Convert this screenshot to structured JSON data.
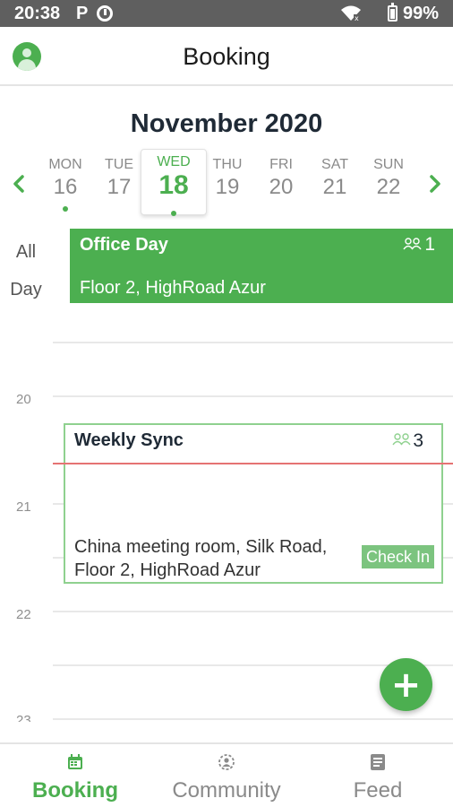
{
  "status_bar": {
    "time": "20:38",
    "notif_p": "P",
    "battery": "99%"
  },
  "header": {
    "title": "Booking",
    "avatar_icon": "user-icon"
  },
  "calendar": {
    "month": "November 2020",
    "prev_icon": "chevron-left-icon",
    "next_icon": "chevron-right-icon",
    "days": [
      {
        "name": "MON",
        "num": "16",
        "has_event": true
      },
      {
        "name": "TUE",
        "num": "17",
        "has_event": false
      },
      {
        "name": "WED",
        "num": "18",
        "has_event": true,
        "selected": true
      },
      {
        "name": "THU",
        "num": "19",
        "has_event": false
      },
      {
        "name": "FRI",
        "num": "20",
        "has_event": false
      },
      {
        "name": "SAT",
        "num": "21",
        "has_event": false
      },
      {
        "name": "SUN",
        "num": "22",
        "has_event": false
      }
    ]
  },
  "all_day": {
    "label_line1": "All",
    "label_line2": "Day",
    "event": {
      "title": "Office Day",
      "location": "Floor 2, HighRoad Azur",
      "attendees": "1"
    }
  },
  "timeline": {
    "hours": [
      "20",
      "21",
      "22",
      "23"
    ],
    "event": {
      "title": "Weekly Sync",
      "attendees": "3",
      "location_line1": "China meeting room, Silk Road,",
      "location_line2": "Floor 2, HighRoad Azur",
      "checkin_label": "Check In"
    }
  },
  "fab": {
    "label": "+"
  },
  "bottom_nav": {
    "tabs": [
      {
        "label": "Booking",
        "icon": "calendar-icon",
        "active": true
      },
      {
        "label": "Community",
        "icon": "community-icon",
        "active": false
      },
      {
        "label": "Feed",
        "icon": "feed-icon",
        "active": false
      }
    ]
  },
  "colors": {
    "accent": "#4caf50",
    "now_line": "#e57373",
    "status_bar": "#5f5f5f"
  }
}
